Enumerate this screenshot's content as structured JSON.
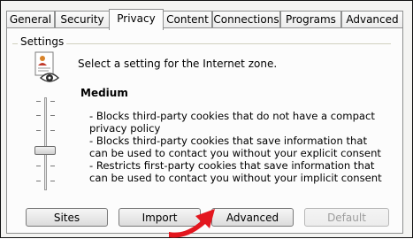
{
  "tabs": [
    {
      "label": "General"
    },
    {
      "label": "Security"
    },
    {
      "label": "Privacy",
      "active": true
    },
    {
      "label": "Content"
    },
    {
      "label": "Connections"
    },
    {
      "label": "Programs"
    },
    {
      "label": "Advanced"
    }
  ],
  "settings": {
    "group_label": "Settings",
    "zone_text": "Select a setting for the Internet zone.",
    "level": "Medium",
    "slider_level_fraction": 0.6,
    "description": [
      "- Blocks third-party cookies that do not have a compact",
      "privacy policy",
      "- Blocks third-party cookies that save information that",
      "can be used to contact you without your explicit consent",
      "- Restricts first-party cookies that save information that",
      "can be used to contact you without your implicit consent"
    ]
  },
  "buttons": {
    "sites": "Sites",
    "import": "Import",
    "advanced": "Advanced",
    "default": "Default"
  },
  "colors": {
    "annotation_arrow": "#e3161e",
    "border": "#8e8f8f"
  },
  "icons": {
    "zone": "privacy-certificate-eye-icon",
    "annotation": "red-arrow-icon"
  }
}
